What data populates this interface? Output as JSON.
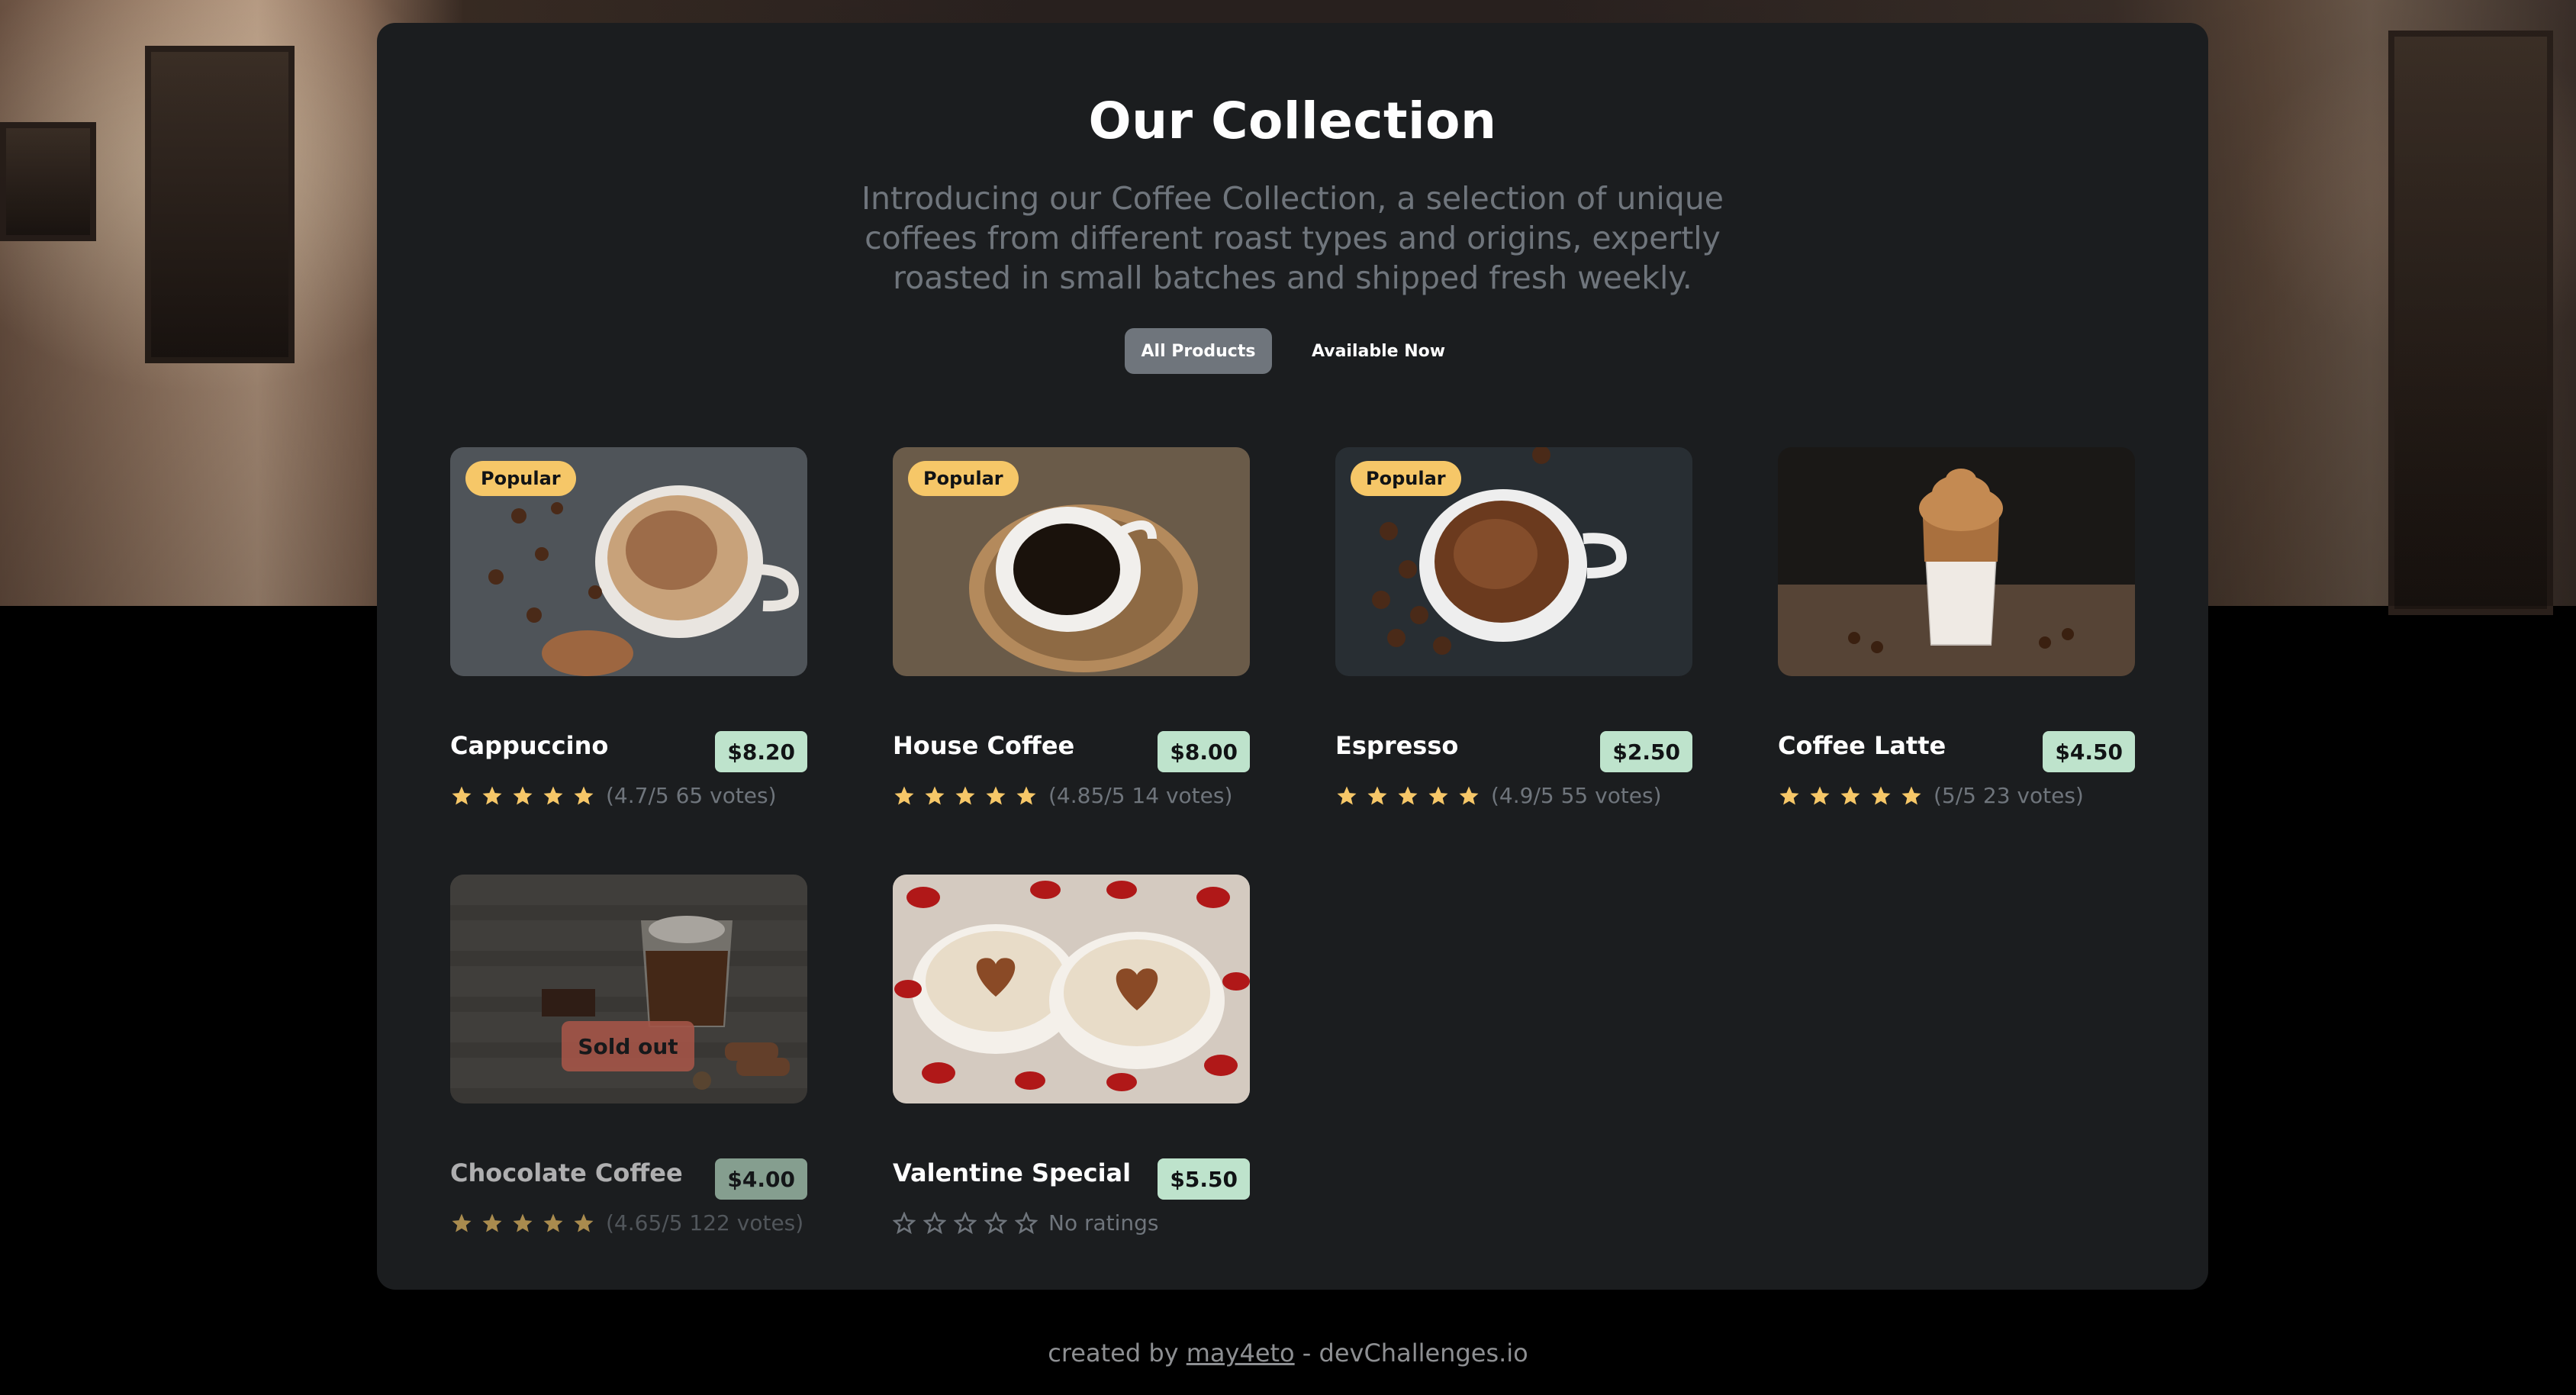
{
  "header": {
    "title": "Our Collection",
    "subtitle": "Introducing our Coffee Collection, a selection of unique coffees from different roast types and origins, expertly roasted in small batches and shipped fresh weekly."
  },
  "tabs": [
    {
      "label": "All Products",
      "active": true
    },
    {
      "label": "Available Now",
      "active": false
    }
  ],
  "products": [
    {
      "name": "Cappuccino",
      "price": "$8.20",
      "badge": "Popular",
      "rating_text": "(4.7/5 65 votes)",
      "stars": 5,
      "sold_out": false,
      "image": "cappuccino"
    },
    {
      "name": "House Coffee",
      "price": "$8.00",
      "badge": "Popular",
      "rating_text": "(4.85/5 14 votes)",
      "stars": 5,
      "sold_out": false,
      "image": "house-coffee"
    },
    {
      "name": "Espresso",
      "price": "$2.50",
      "badge": "Popular",
      "rating_text": "(4.9/5 55 votes)",
      "stars": 5,
      "sold_out": false,
      "image": "espresso"
    },
    {
      "name": "Coffee Latte",
      "price": "$4.50",
      "badge": "",
      "rating_text": "(5/5 23 votes)",
      "stars": 5,
      "sold_out": false,
      "image": "coffee-latte"
    },
    {
      "name": "Chocolate Coffee",
      "price": "$4.00",
      "badge": "",
      "rating_text": "(4.65/5 122 votes)",
      "stars": 5,
      "sold_out": true,
      "sold_out_label": "Sold out",
      "image": "chocolate-coffee"
    },
    {
      "name": "Valentine Special",
      "price": "$5.50",
      "badge": "",
      "rating_text": "No ratings",
      "stars": 0,
      "sold_out": false,
      "image": "valentine-special"
    }
  ],
  "footer": {
    "prefix": "created by",
    "author": "may4eto",
    "suffix": "- devChallenges.io"
  },
  "colors": {
    "background": "#000000",
    "panel": "#1b1d1f",
    "title": "#fefefe",
    "muted": "#6f757c",
    "badge": "#f6c768",
    "price": "#bee3cc",
    "sold_out": "#ed735d",
    "star": "#f6c768"
  }
}
